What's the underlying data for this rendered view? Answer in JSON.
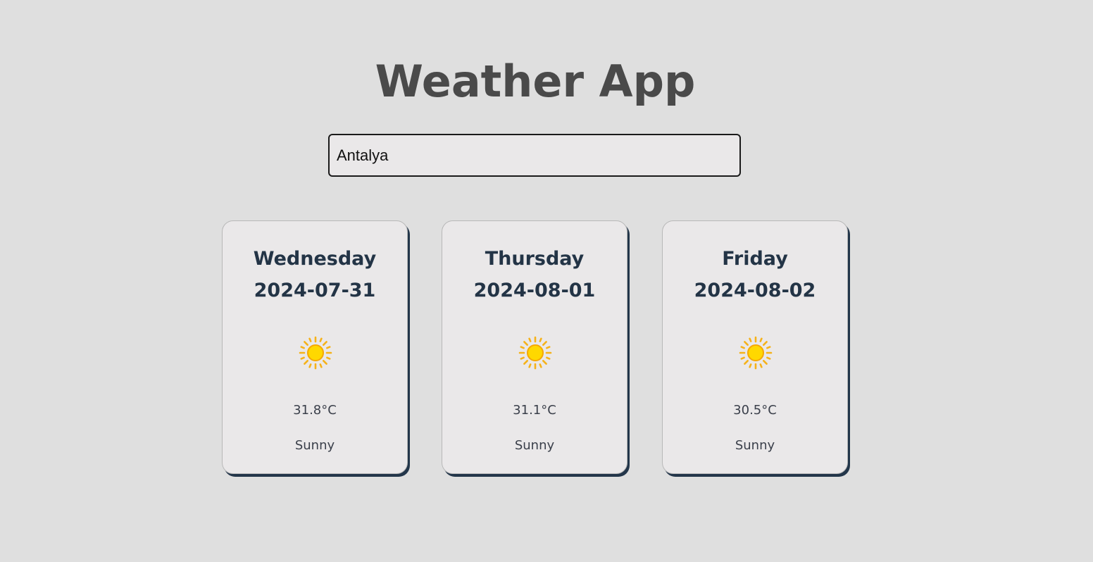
{
  "app": {
    "title": "Weather App"
  },
  "search": {
    "value": "Antalya"
  },
  "forecast": [
    {
      "day": "Wednesday",
      "date": "2024-07-31",
      "icon": "sun-icon",
      "temp": "31.8°C",
      "condition": "Sunny"
    },
    {
      "day": "Thursday",
      "date": "2024-08-01",
      "icon": "sun-icon",
      "temp": "31.1°C",
      "condition": "Sunny"
    },
    {
      "day": "Friday",
      "date": "2024-08-02",
      "icon": "sun-icon",
      "temp": "30.5°C",
      "condition": "Sunny"
    }
  ],
  "colors": {
    "background": "#dfdfdf",
    "card": "#eae8e9",
    "card_shadow": "#23364a",
    "heading": "#4a4a4a",
    "card_text": "#233446",
    "sun": "#ffcc00"
  }
}
